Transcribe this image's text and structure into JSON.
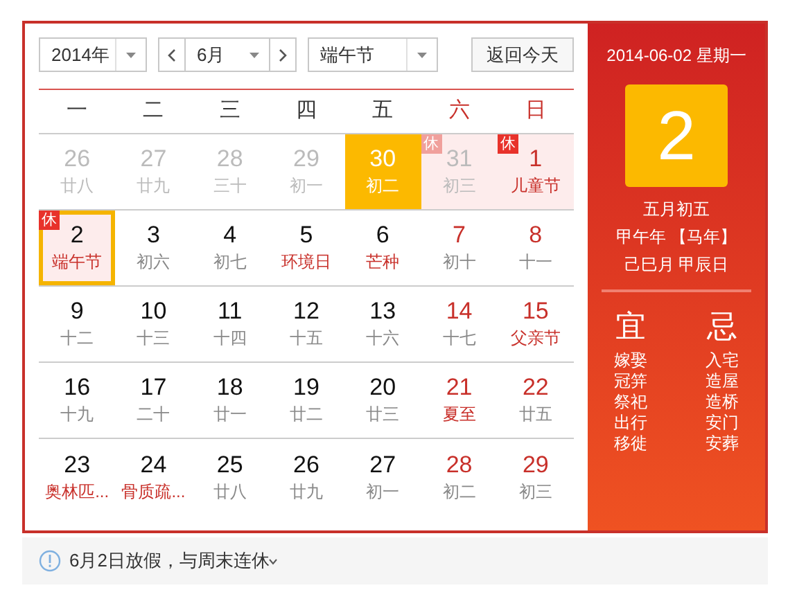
{
  "controls": {
    "year": "2014年",
    "month": "6月",
    "holiday": "端午节",
    "today_button": "返回今天"
  },
  "weekdays": [
    {
      "label": "一",
      "weekend": false
    },
    {
      "label": "二",
      "weekend": false
    },
    {
      "label": "三",
      "weekend": false
    },
    {
      "label": "四",
      "weekend": false
    },
    {
      "label": "五",
      "weekend": false
    },
    {
      "label": "六",
      "weekend": true
    },
    {
      "label": "日",
      "weekend": true
    }
  ],
  "weeks": [
    [
      {
        "day": "26",
        "lunar": "廿八",
        "other_month": true,
        "weekend": false,
        "festival": false,
        "rest": false,
        "highlighted": false,
        "selected": false
      },
      {
        "day": "27",
        "lunar": "廿九",
        "other_month": true,
        "weekend": false,
        "festival": false,
        "rest": false,
        "highlighted": false,
        "selected": false
      },
      {
        "day": "28",
        "lunar": "三十",
        "other_month": true,
        "weekend": false,
        "festival": false,
        "rest": false,
        "highlighted": false,
        "selected": false
      },
      {
        "day": "29",
        "lunar": "初一",
        "other_month": true,
        "weekend": false,
        "festival": false,
        "rest": false,
        "highlighted": false,
        "selected": false
      },
      {
        "day": "30",
        "lunar": "初二",
        "other_month": true,
        "weekend": false,
        "festival": false,
        "rest": false,
        "highlighted": true,
        "selected": false
      },
      {
        "day": "31",
        "lunar": "初三",
        "other_month": true,
        "weekend": true,
        "festival": false,
        "rest": true,
        "rest_tag": "休",
        "highlighted": false,
        "selected": false
      },
      {
        "day": "1",
        "lunar": "儿童节",
        "other_month": false,
        "weekend": true,
        "festival": true,
        "rest": true,
        "rest_tag": "休",
        "highlighted": false,
        "selected": false
      }
    ],
    [
      {
        "day": "2",
        "lunar": "端午节",
        "other_month": false,
        "weekend": false,
        "festival": true,
        "rest": true,
        "rest_tag": "休",
        "highlighted": false,
        "selected": true
      },
      {
        "day": "3",
        "lunar": "初六",
        "other_month": false,
        "weekend": false,
        "festival": false,
        "rest": false,
        "highlighted": false,
        "selected": false
      },
      {
        "day": "4",
        "lunar": "初七",
        "other_month": false,
        "weekend": false,
        "festival": false,
        "rest": false,
        "highlighted": false,
        "selected": false
      },
      {
        "day": "5",
        "lunar": "环境日",
        "other_month": false,
        "weekend": false,
        "festival": true,
        "rest": false,
        "highlighted": false,
        "selected": false
      },
      {
        "day": "6",
        "lunar": "芒种",
        "other_month": false,
        "weekend": false,
        "festival": true,
        "rest": false,
        "highlighted": false,
        "selected": false
      },
      {
        "day": "7",
        "lunar": "初十",
        "other_month": false,
        "weekend": true,
        "festival": false,
        "rest": false,
        "highlighted": false,
        "selected": false
      },
      {
        "day": "8",
        "lunar": "十一",
        "other_month": false,
        "weekend": true,
        "festival": false,
        "rest": false,
        "highlighted": false,
        "selected": false
      }
    ],
    [
      {
        "day": "9",
        "lunar": "十二",
        "other_month": false,
        "weekend": false,
        "festival": false,
        "rest": false,
        "highlighted": false,
        "selected": false
      },
      {
        "day": "10",
        "lunar": "十三",
        "other_month": false,
        "weekend": false,
        "festival": false,
        "rest": false,
        "highlighted": false,
        "selected": false
      },
      {
        "day": "11",
        "lunar": "十四",
        "other_month": false,
        "weekend": false,
        "festival": false,
        "rest": false,
        "highlighted": false,
        "selected": false
      },
      {
        "day": "12",
        "lunar": "十五",
        "other_month": false,
        "weekend": false,
        "festival": false,
        "rest": false,
        "highlighted": false,
        "selected": false
      },
      {
        "day": "13",
        "lunar": "十六",
        "other_month": false,
        "weekend": false,
        "festival": false,
        "rest": false,
        "highlighted": false,
        "selected": false
      },
      {
        "day": "14",
        "lunar": "十七",
        "other_month": false,
        "weekend": true,
        "festival": false,
        "rest": false,
        "highlighted": false,
        "selected": false
      },
      {
        "day": "15",
        "lunar": "父亲节",
        "other_month": false,
        "weekend": true,
        "festival": true,
        "rest": false,
        "highlighted": false,
        "selected": false
      }
    ],
    [
      {
        "day": "16",
        "lunar": "十九",
        "other_month": false,
        "weekend": false,
        "festival": false,
        "rest": false,
        "highlighted": false,
        "selected": false
      },
      {
        "day": "17",
        "lunar": "二十",
        "other_month": false,
        "weekend": false,
        "festival": false,
        "rest": false,
        "highlighted": false,
        "selected": false
      },
      {
        "day": "18",
        "lunar": "廿一",
        "other_month": false,
        "weekend": false,
        "festival": false,
        "rest": false,
        "highlighted": false,
        "selected": false
      },
      {
        "day": "19",
        "lunar": "廿二",
        "other_month": false,
        "weekend": false,
        "festival": false,
        "rest": false,
        "highlighted": false,
        "selected": false
      },
      {
        "day": "20",
        "lunar": "廿三",
        "other_month": false,
        "weekend": false,
        "festival": false,
        "rest": false,
        "highlighted": false,
        "selected": false
      },
      {
        "day": "21",
        "lunar": "夏至",
        "other_month": false,
        "weekend": true,
        "festival": true,
        "rest": false,
        "highlighted": false,
        "selected": false
      },
      {
        "day": "22",
        "lunar": "廿五",
        "other_month": false,
        "weekend": true,
        "festival": false,
        "rest": false,
        "highlighted": false,
        "selected": false
      }
    ],
    [
      {
        "day": "23",
        "lunar": "奥林匹...",
        "other_month": false,
        "weekend": false,
        "festival": true,
        "rest": false,
        "highlighted": false,
        "selected": false
      },
      {
        "day": "24",
        "lunar": "骨质疏...",
        "other_month": false,
        "weekend": false,
        "festival": true,
        "rest": false,
        "highlighted": false,
        "selected": false
      },
      {
        "day": "25",
        "lunar": "廿八",
        "other_month": false,
        "weekend": false,
        "festival": false,
        "rest": false,
        "highlighted": false,
        "selected": false
      },
      {
        "day": "26",
        "lunar": "廿九",
        "other_month": false,
        "weekend": false,
        "festival": false,
        "rest": false,
        "highlighted": false,
        "selected": false
      },
      {
        "day": "27",
        "lunar": "初一",
        "other_month": false,
        "weekend": false,
        "festival": false,
        "rest": false,
        "highlighted": false,
        "selected": false
      },
      {
        "day": "28",
        "lunar": "初二",
        "other_month": false,
        "weekend": true,
        "festival": false,
        "rest": false,
        "highlighted": false,
        "selected": false
      },
      {
        "day": "29",
        "lunar": "初三",
        "other_month": false,
        "weekend": true,
        "festival": false,
        "rest": false,
        "highlighted": false,
        "selected": false
      }
    ]
  ],
  "detail": {
    "date_line": "2014-06-02 星期一",
    "day": "2",
    "lunar_lines": [
      "五月初五",
      "甲午年 【马年】",
      "己巳月 甲辰日"
    ],
    "good": {
      "title": "宜",
      "items": [
        "嫁娶",
        "冠笄",
        "祭祀",
        "出行",
        "移徙"
      ]
    },
    "bad": {
      "title": "忌",
      "items": [
        "入宅",
        "造屋",
        "造桥",
        "安门",
        "安葬"
      ]
    }
  },
  "notice": {
    "text": "6月2日放假，与周末连休"
  }
}
